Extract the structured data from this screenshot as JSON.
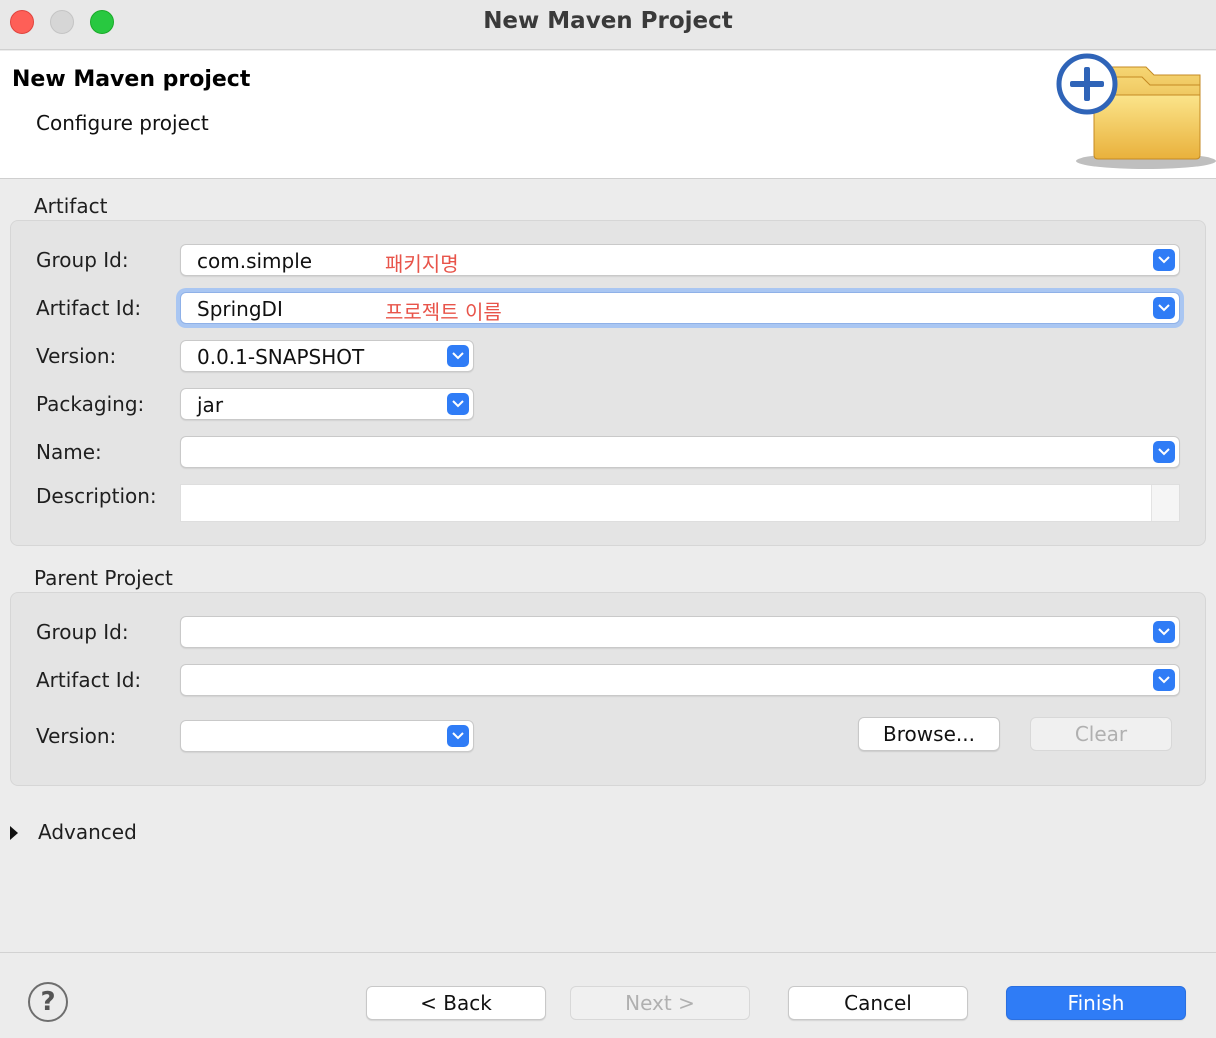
{
  "window": {
    "title": "New Maven Project"
  },
  "banner": {
    "title": "New Maven project",
    "subtitle": "Configure project",
    "icon": "new-maven-folder-icon"
  },
  "artifact": {
    "group_label": "Artifact",
    "group_id_label": "Group Id:",
    "group_id_value": "com.simple",
    "group_id_note": "패키지명",
    "artifact_id_label": "Artifact Id:",
    "artifact_id_value": "SpringDI",
    "artifact_id_note": "프로젝트 이름",
    "version_label": "Version:",
    "version_value": "0.0.1-SNAPSHOT",
    "packaging_label": "Packaging:",
    "packaging_value": "jar",
    "name_label": "Name:",
    "name_value": "",
    "description_label": "Description:",
    "description_value": ""
  },
  "parent": {
    "group_label": "Parent Project",
    "group_id_label": "Group Id:",
    "group_id_value": "",
    "artifact_id_label": "Artifact Id:",
    "artifact_id_value": "",
    "version_label": "Version:",
    "version_value": "",
    "browse_label": "Browse...",
    "clear_label": "Clear"
  },
  "advanced": {
    "label": "Advanced"
  },
  "footer": {
    "help_label": "?",
    "back_label": "< Back",
    "next_label": "Next >",
    "cancel_label": "Cancel",
    "finish_label": "Finish"
  },
  "colors": {
    "accent": "#2f7cf6",
    "annotation": "#e8544a"
  }
}
